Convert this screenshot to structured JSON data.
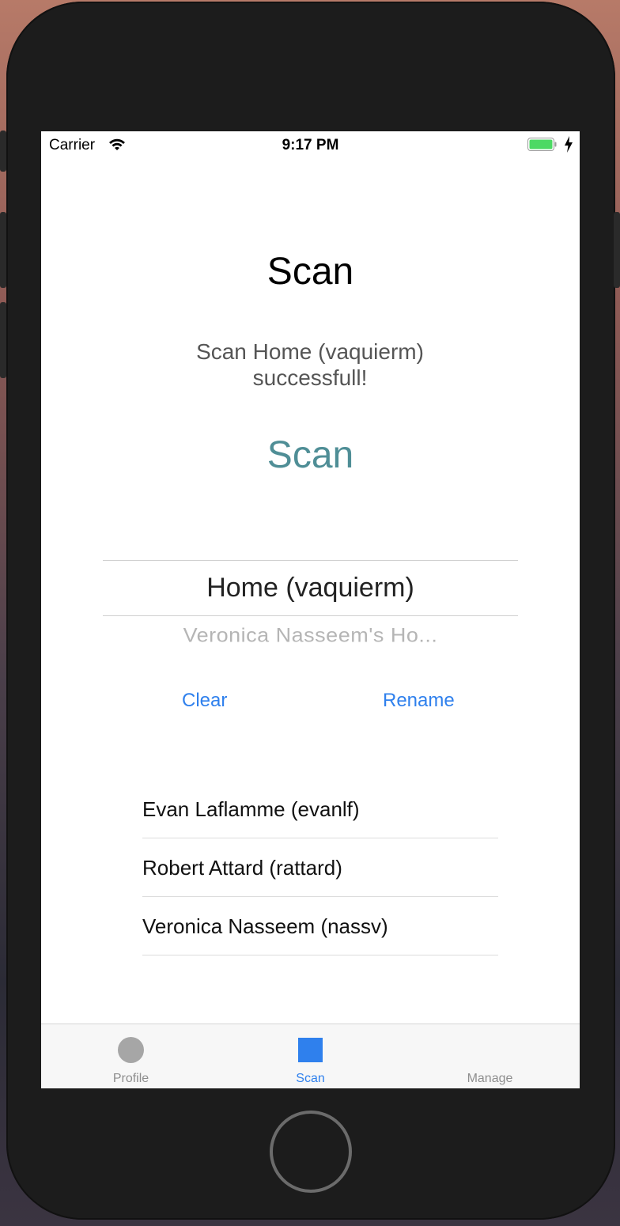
{
  "status_bar": {
    "carrier": "Carrier",
    "time": "9:17 PM"
  },
  "main": {
    "title": "Scan",
    "message": "Scan Home (vaquierm) successfull!",
    "scan_button": "Scan"
  },
  "picker": {
    "selected": "Home (vaquierm)",
    "next": "Veronica Nasseem's Ho..."
  },
  "actions": {
    "clear": "Clear",
    "rename": "Rename"
  },
  "users": [
    "Evan Laflamme (evanlf)",
    "Robert Attard (rattard)",
    "Veronica Nasseem (nassv)"
  ],
  "tab_bar": {
    "tabs": [
      {
        "label": "Profile",
        "icon": "circle-icon",
        "active": false
      },
      {
        "label": "Scan",
        "icon": "square-icon",
        "active": true
      },
      {
        "label": "Manage",
        "icon": "",
        "active": false
      }
    ]
  },
  "colors": {
    "accent": "#2f80ed",
    "scan_teal": "#4f8e96",
    "battery_green": "#4cd964"
  }
}
